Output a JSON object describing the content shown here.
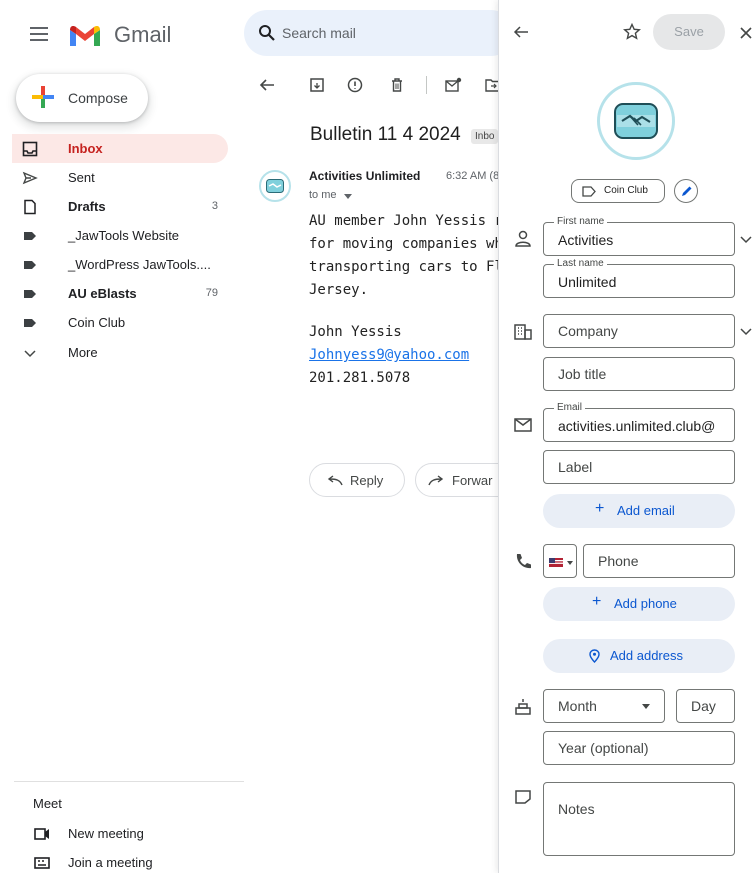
{
  "app": {
    "name": "Gmail"
  },
  "sidebar": {
    "compose_label": "Compose",
    "items": [
      {
        "label": "Inbox",
        "icon": "inbox-icon",
        "count": "",
        "active": true,
        "bold": true
      },
      {
        "label": "Sent",
        "icon": "send-icon",
        "count": "",
        "active": false,
        "bold": false
      },
      {
        "label": "Drafts",
        "icon": "draft-icon",
        "count": "3",
        "active": false,
        "bold": true
      },
      {
        "label": "_JawTools Website",
        "icon": "label-icon",
        "count": "",
        "active": false,
        "bold": false
      },
      {
        "label": "_WordPress JawTools....",
        "icon": "label-icon",
        "count": "",
        "active": false,
        "bold": false
      },
      {
        "label": "AU eBlasts",
        "icon": "label-icon",
        "count": "79",
        "active": false,
        "bold": true
      },
      {
        "label": "Coin Club",
        "icon": "label-icon",
        "count": "",
        "active": false,
        "bold": false
      },
      {
        "label": "More",
        "icon": "chevron-down-icon",
        "count": "",
        "active": false,
        "bold": false
      }
    ],
    "meet": {
      "heading": "Meet",
      "new_meeting": "New meeting",
      "join_meeting": "Join a meeting"
    }
  },
  "search": {
    "placeholder": "Search mail"
  },
  "email": {
    "subject": "Bulletin 11 4 2024",
    "label_chip": "Inbo",
    "sender": "Activities Unlimited",
    "time": "6:32 AM (8",
    "to": "to me",
    "body_lines": [
      "AU member John Yessis r",
      "for moving companies wh",
      "transporting cars to Florid",
      "Jersey.",
      "",
      "John Yessis",
      "Johnyess9@yahoo.com",
      "201.281.5078"
    ],
    "reply_label": "Reply",
    "forward_label": "Forwar"
  },
  "contact_panel": {
    "save_label": "Save",
    "label_chip": "Coin Club",
    "first_name_label": "First name",
    "first_name": "Activities",
    "last_name_label": "Last name",
    "last_name": "Unlimited",
    "company_placeholder": "Company",
    "job_title_placeholder": "Job title",
    "email_label": "Email",
    "email_value": "activities.unlimited.club@",
    "email_label_placeholder": "Label",
    "add_email": "Add email",
    "phone_placeholder": "Phone",
    "add_phone": "Add phone",
    "add_address": "Add address",
    "month_placeholder": "Month",
    "day_placeholder": "Day",
    "year_placeholder": "Year (optional)",
    "notes_placeholder": "Notes"
  },
  "colors": {
    "accent": "#0b57d0",
    "active_nav_bg": "#fce8e6",
    "active_nav_text": "#c5221f",
    "search_bg": "#eaf1fb",
    "pill_bg": "#e9eef6",
    "avatar_ring": "#b6e2ea"
  }
}
